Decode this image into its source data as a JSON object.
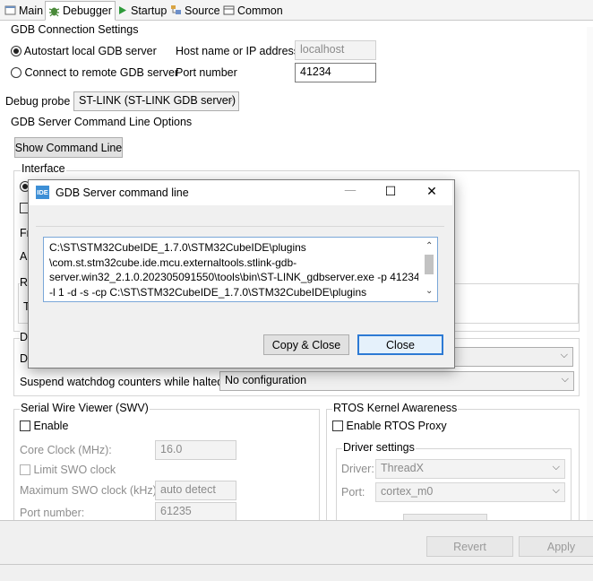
{
  "tabs": [
    {
      "label": "Main",
      "icon": "main-tab-icon"
    },
    {
      "label": "Debugger",
      "icon": "debugger-tab-icon"
    },
    {
      "label": "Startup",
      "icon": "startup-tab-icon"
    },
    {
      "label": "Source",
      "icon": "source-tab-icon"
    },
    {
      "label": "Common",
      "icon": "common-tab-icon"
    }
  ],
  "gdb_connection": {
    "title": "GDB Connection Settings",
    "autostart_label": "Autostart local GDB server",
    "remote_label": "Connect to remote GDB server",
    "host_label": "Host name or IP address",
    "host_value": "localhost",
    "port_label": "Port number",
    "port_value": "41234"
  },
  "debug_probe": {
    "label": "Debug probe",
    "value": "ST-LINK (ST-LINK GDB server)"
  },
  "server_options": {
    "title": "GDB Server Command Line Options",
    "show_cmd_button": "Show Command Line",
    "interface_label": "Interface",
    "hidden_labels": [
      "Fr",
      "A",
      "R",
      "T",
      "D",
      "D"
    ]
  },
  "watchdog": {
    "label": "Suspend watchdog counters while halted:",
    "value": "No configuration"
  },
  "swv": {
    "title": "Serial Wire Viewer (SWV)",
    "enable_label": "Enable",
    "core_clock_label": "Core Clock (MHz):",
    "core_clock_value": "16.0",
    "limit_swo_label": "Limit SWO clock",
    "max_swo_label": "Maximum SWO clock (kHz):",
    "max_swo_value": "auto detect",
    "port_label": "Port number:",
    "port_value": "61235"
  },
  "rtos": {
    "title": "RTOS Kernel Awareness",
    "enable_label": "Enable RTOS Proxy",
    "driver_settings_title": "Driver settings",
    "driver_label": "Driver:",
    "driver_value": "ThreadX",
    "port_label": "Port:",
    "port_value": "cortex_m0"
  },
  "footer": {
    "revert_label": "Revert",
    "apply_label": "Apply"
  },
  "dialog": {
    "icon_text": "IDE",
    "title": "GDB Server command line",
    "minimize_glyph": "—",
    "maximize_glyph": "☐",
    "close_glyph": "✕",
    "command_lines": [
      "C:\\ST\\STM32CubeIDE_1.7.0\\STM32CubeIDE\\plugins",
      "\\com.st.stm32cube.ide.mcu.externaltools.stlink-gdb-",
      "server.win32_2.1.0.202305091550\\tools\\bin\\ST-LINK_gdbserver.exe -p 41234",
      "-l 1 -d -s -cp C:\\ST\\STM32CubeIDE_1.7.0\\STM32CubeIDE\\plugins"
    ],
    "copy_close_label": "Copy & Close",
    "close_label": "Close"
  }
}
